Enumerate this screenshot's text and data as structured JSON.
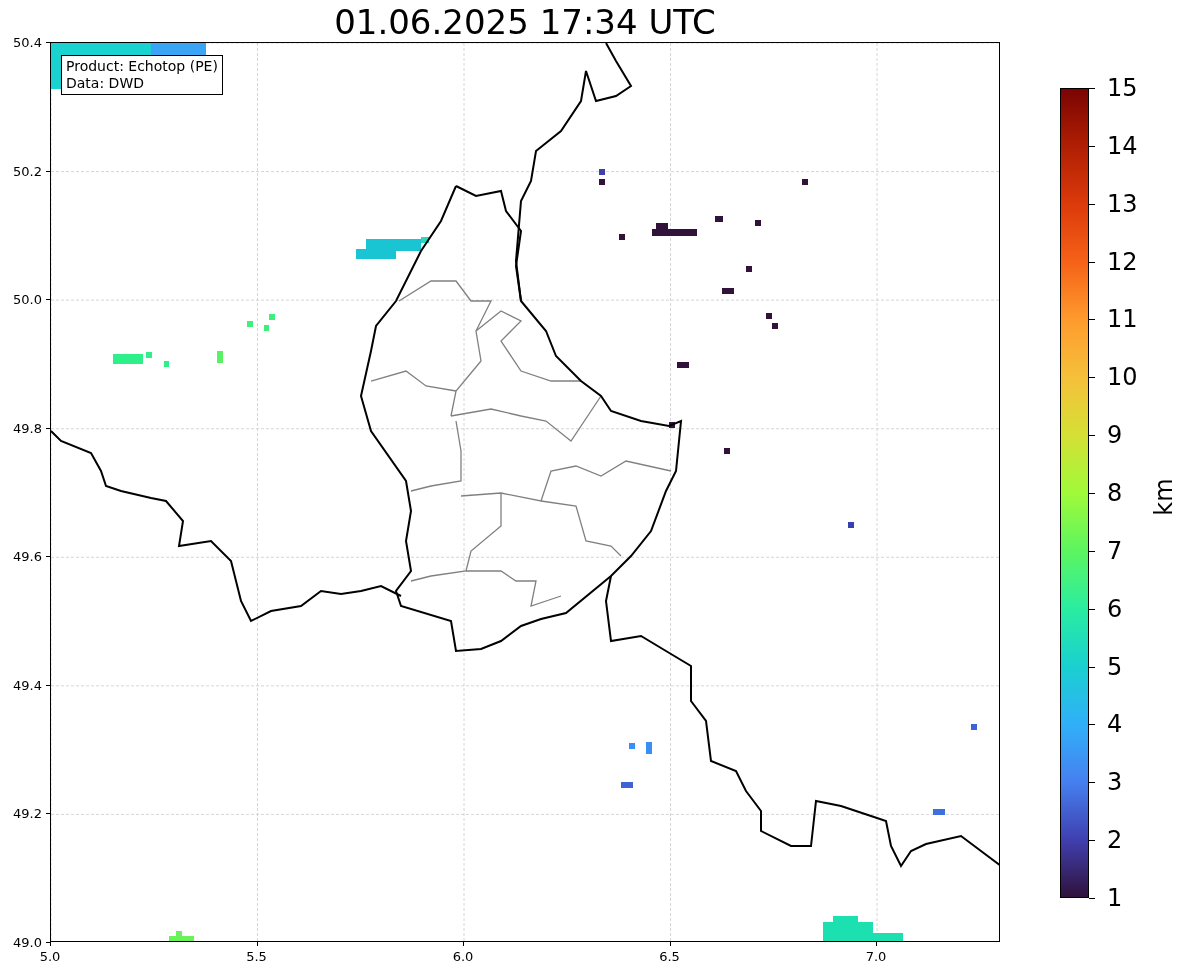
{
  "title": "01.06.2025 17:34 UTC",
  "map": {
    "info_box": [
      "Product: Echotop (PE)",
      "Data: DWD"
    ],
    "x_ticks": [
      "5.0",
      "5.5",
      "6.0",
      "6.5",
      "7.0"
    ],
    "y_ticks": [
      "50.4",
      "50.2",
      "50.0",
      "49.8",
      "49.6",
      "49.4",
      "49.2",
      "49.0"
    ]
  },
  "colorbar": {
    "label": "km",
    "ticks": [
      "15",
      "14",
      "13",
      "12",
      "11",
      "10",
      "9",
      "8",
      "7",
      "6",
      "5",
      "4",
      "3",
      "2",
      "1"
    ]
  }
}
